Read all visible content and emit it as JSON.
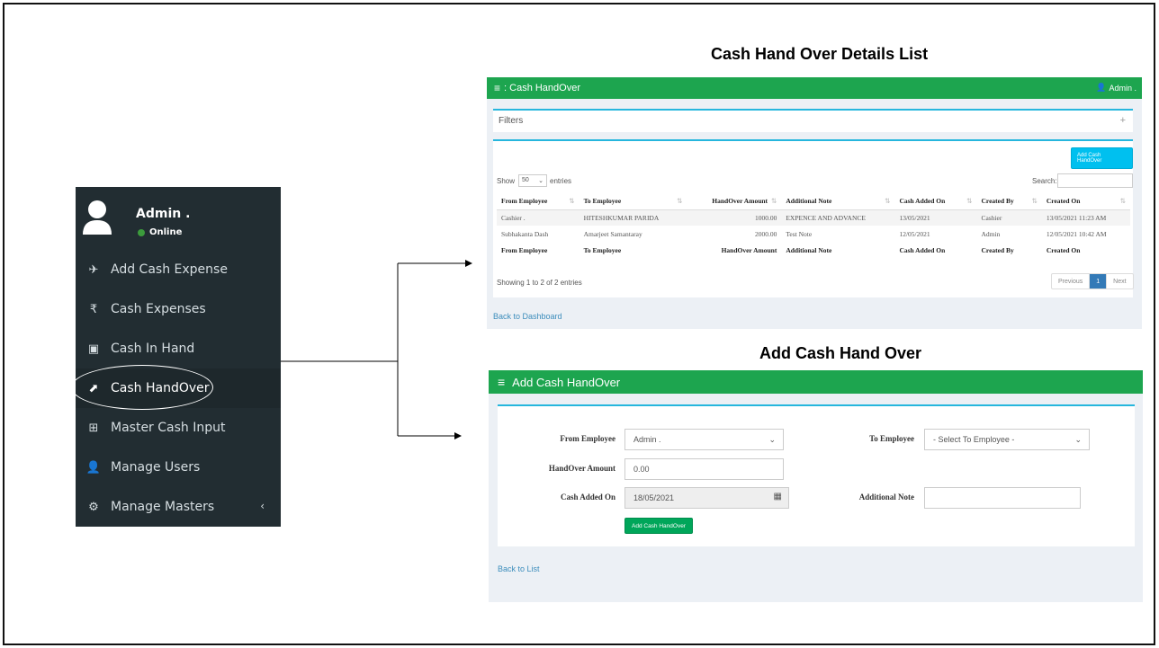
{
  "sidebar": {
    "user_name": "Admin .",
    "status": "Online",
    "items": [
      {
        "label": "Add Cash Expense",
        "icon": "paper-plane-icon",
        "glyph": "✈"
      },
      {
        "label": "Cash Expenses",
        "icon": "rupee-icon",
        "glyph": "₹"
      },
      {
        "label": "Cash In Hand",
        "icon": "money-icon",
        "glyph": "▣"
      },
      {
        "label": "Cash HandOver",
        "icon": "share-square-icon",
        "glyph": "⬈",
        "active": true
      },
      {
        "label": "Master Cash Input",
        "icon": "plus-square-icon",
        "glyph": "⊞"
      },
      {
        "label": "Manage Users",
        "icon": "user-icon",
        "glyph": "👤"
      },
      {
        "label": "Manage Masters",
        "icon": "gear-icon",
        "glyph": "⚙",
        "chevron": "‹"
      }
    ]
  },
  "list_view": {
    "section_title": "Cash Hand Over Details List",
    "header_title": ": Cash HandOver",
    "admin_label": "Admin .",
    "filters_label": "Filters",
    "filters_toggle": "+",
    "add_button": "Add Cash HandOver",
    "show_label": "Show",
    "entries_value": "50",
    "entries_label": "entries",
    "search_label": "Search:",
    "columns": [
      "From Employee",
      "To Employee",
      "HandOver Amount",
      "Additional Note",
      "Cash Added On",
      "Created By",
      "Created On"
    ],
    "rows": [
      [
        "Cashier .",
        "HITESHKUMAR PARIDA",
        "1000.00",
        "EXPENCE AND ADVANCE",
        "13/05/2021",
        "Cashier",
        "13/05/2021 11:23 AM"
      ],
      [
        "Subhakanta Dash",
        "Amarjeet Samantaray",
        "2000.00",
        "Test Note",
        "12/05/2021",
        "Admin",
        "12/05/2021 10:42 AM"
      ]
    ],
    "info": "Showing 1 to 2 of 2 entries",
    "pager": {
      "previous": "Previous",
      "current": "1",
      "next": "Next"
    },
    "back_link": "Back to Dashboard"
  },
  "add_view": {
    "section_title": "Add Cash Hand Over",
    "header_title": "Add Cash HandOver",
    "from_employee_label": "From Employee",
    "from_employee_value": "Admin .",
    "to_employee_label": "To Employee",
    "to_employee_value": "- Select To Employee -",
    "amount_label": "HandOver Amount",
    "amount_value": "0.00",
    "cash_added_label": "Cash Added On",
    "cash_added_value": "18/05/2021",
    "note_label": "Additional Note",
    "note_value": "",
    "submit_button": "Add Cash HandOver",
    "back_link": "Back to List"
  },
  "colors": {
    "sidebar_bg": "#222d32",
    "header_green": "#1da54f",
    "accent_cyan": "#00c0ef",
    "button_green": "#00a65a",
    "link_blue": "#3c8dbc"
  }
}
